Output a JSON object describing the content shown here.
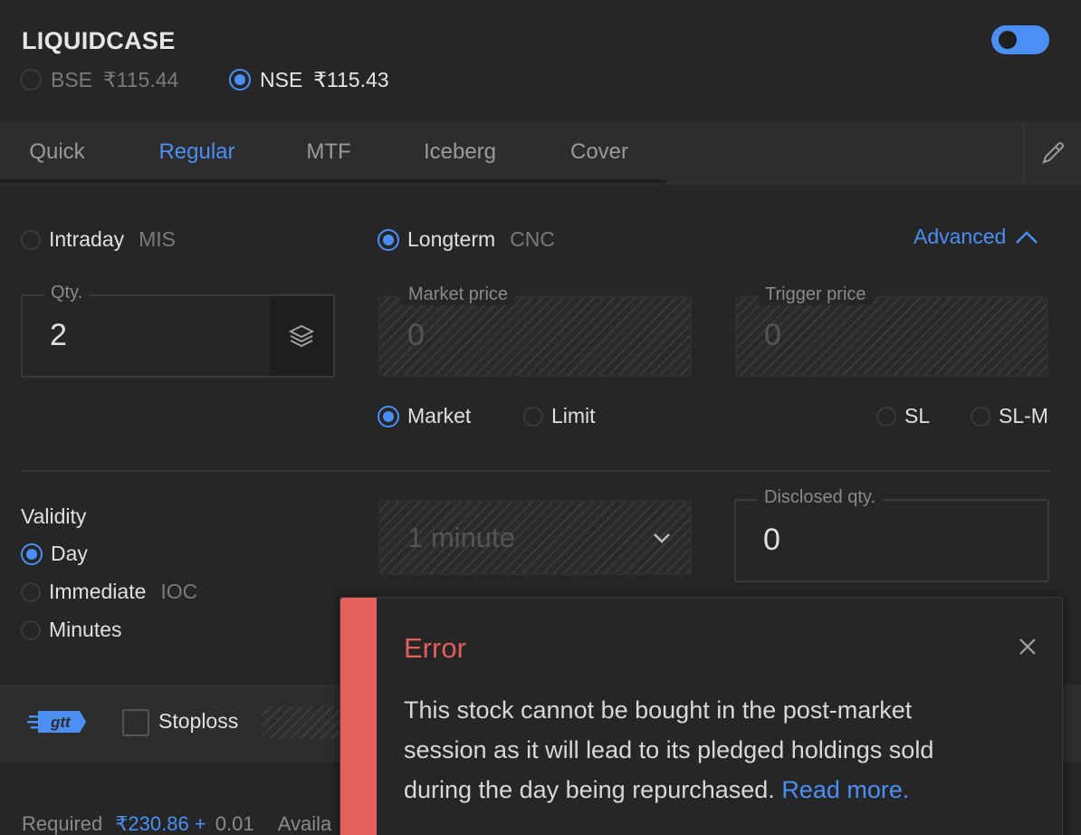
{
  "header": {
    "symbol": "LIQUIDCASE",
    "exchanges": [
      {
        "label": "BSE",
        "price": "₹115.44",
        "selected": false
      },
      {
        "label": "NSE",
        "price": "₹115.43",
        "selected": true
      }
    ],
    "toggle_on": true
  },
  "tabs": [
    "Quick",
    "Regular",
    "MTF",
    "Iceberg",
    "Cover"
  ],
  "active_tab": "Regular",
  "product": {
    "intraday": {
      "label": "Intraday",
      "code": "MIS"
    },
    "longterm": {
      "label": "Longterm",
      "code": "CNC"
    },
    "selected": "Longterm"
  },
  "advanced_label": "Advanced",
  "fields": {
    "qty": {
      "label": "Qty.",
      "value": "2"
    },
    "market_price": {
      "label": "Market price",
      "value": "0"
    },
    "trigger_price": {
      "label": "Trigger price",
      "value": "0"
    },
    "disclosed_qty": {
      "label": "Disclosed qty.",
      "value": "0"
    }
  },
  "order_types": [
    "Market",
    "Limit",
    "SL",
    "SL-M"
  ],
  "selected_order_type": "Market",
  "validity": {
    "label": "Validity",
    "options": [
      {
        "label": "Day",
        "code": ""
      },
      {
        "label": "Immediate",
        "code": "IOC"
      },
      {
        "label": "Minutes",
        "code": ""
      }
    ],
    "selected": "Day",
    "minutes_select": "1 minute"
  },
  "bottom": {
    "gtt_label": "gtt",
    "stoploss_label": "Stoploss"
  },
  "footer": {
    "required_label": "Required",
    "required_value": "₹230.86 +",
    "charges": "0.01",
    "available_label": "Availa"
  },
  "toast": {
    "title": "Error",
    "message": "This stock cannot be bought in the post-market session as it will lead to its pledged holdings sold during the day being repurchased.",
    "link": "Read more."
  },
  "colors": {
    "accent": "#4b8ff5",
    "error": "#e25f5b",
    "background": "#262626"
  }
}
